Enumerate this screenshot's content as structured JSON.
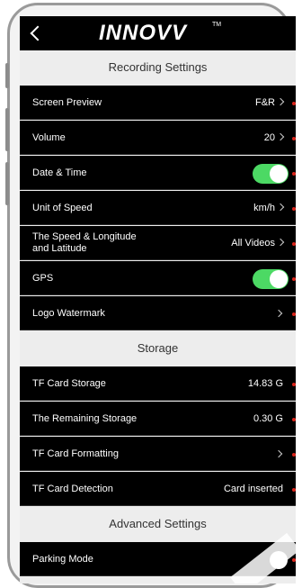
{
  "header": {
    "back_label": "",
    "brand": "INNOVV",
    "trademark": "TM"
  },
  "sections": {
    "recording": "Recording Settings",
    "storage": "Storage",
    "advanced": "Advanced Settings"
  },
  "rows": {
    "screen_preview": {
      "label": "Screen Preview",
      "value": "F&R"
    },
    "volume": {
      "label": "Volume",
      "value": "20"
    },
    "date_time": {
      "label": "Date & Time",
      "toggle": "on"
    },
    "unit_speed": {
      "label": "Unit of Speed",
      "value": "km/h"
    },
    "speed_lat": {
      "label_line1": "The Speed & Longitude",
      "label_line2": "and Latitude",
      "value": "All Videos"
    },
    "gps": {
      "label": "GPS",
      "toggle": "on"
    },
    "logo_watermark": {
      "label": "Logo Watermark"
    },
    "tf_storage": {
      "label": "TF Card Storage",
      "value": "14.83 G"
    },
    "remaining": {
      "label": "The Remaining Storage",
      "value": "0.30 G"
    },
    "formatting": {
      "label": "TF Card Formatting"
    },
    "detection": {
      "label": "TF Card Detection",
      "value": "Card inserted"
    },
    "parking": {
      "label": "Parking Mode",
      "toggle": "off"
    }
  },
  "colors": {
    "toggle_on": "#4cd964",
    "row_bg": "#000000",
    "section_bg": "#ededed",
    "marker": "#d9261c"
  }
}
